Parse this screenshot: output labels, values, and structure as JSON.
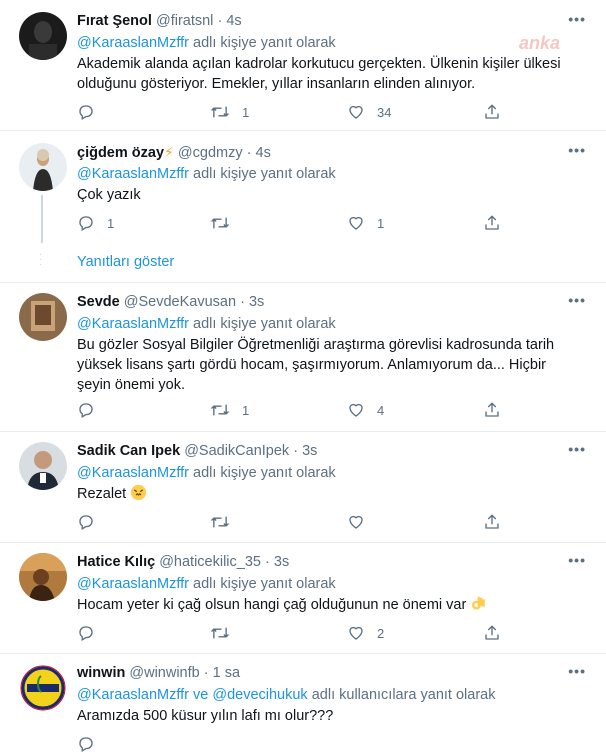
{
  "watermark": "anka",
  "reply_label": "adlı kişiye yanıt olarak",
  "reply_label_multi": "adlı kullanıcılara yanıt olarak",
  "show_replies": "Yanıtları göster",
  "more_glyph": "•••",
  "tweets": [
    {
      "name": "Fırat Şenol",
      "handle": "@firatsnl",
      "sep": "·",
      "time": "4s",
      "reply_to": "@KaraaslanMzffr",
      "lines": [
        "Akademik alanda açılan kadrolar korkutucu gerçekten. Ülkenin kişiler ülkesi",
        "olduğunu gösteriyor. Emekler, yıllar insanların elinden alınıyor."
      ],
      "replies": "",
      "retweets": "1",
      "likes": "34"
    },
    {
      "name": "çiğdem özay",
      "handle": "@cgdmzy",
      "sep": "·",
      "time": "4s",
      "reply_to": "@KaraaslanMzffr",
      "lines": [
        "Çok yazık"
      ],
      "replies": "1",
      "retweets": "",
      "likes": "1"
    },
    {
      "name": "Sevde",
      "handle": "@SevdeKavusan",
      "sep": "·",
      "time": "3s",
      "reply_to": "@KaraaslanMzffr",
      "lines": [
        "Bu gözler Sosyal Bilgiler Öğretmenliği araştırma görevlisi kadrosunda tarih",
        "yüksek lisans şartı gördü hocam, şaşırmıyorum. Anlamıyorum da... Hiçbir",
        "şeyin önemi yok."
      ],
      "replies": "",
      "retweets": "1",
      "likes": "4"
    },
    {
      "name": "Sadik Can Ipek",
      "handle": "@SadikCanIpek",
      "sep": "·",
      "time": "3s",
      "reply_to": "@KaraaslanMzffr",
      "lines": [
        "Rezalet"
      ],
      "replies": "",
      "retweets": "",
      "likes": ""
    },
    {
      "name": "Hatice Kılıç",
      "handle": "@haticekilic_35",
      "sep": "·",
      "time": "3s",
      "reply_to": "@KaraaslanMzffr",
      "lines": [
        "Hocam yeter ki çağ olsun hangi çağ olduğunun ne önemi var"
      ],
      "replies": "",
      "retweets": "",
      "likes": "2"
    },
    {
      "name": "winwin",
      "handle": "@winwinfb",
      "sep": "·",
      "time": "1 sa",
      "reply_to": "@KaraaslanMzffr",
      "reply_joiner": "ve",
      "reply_to_2": "@devecihukuk",
      "lines": [
        "Aramızda 500 küsur yılın lafı mı olur???"
      ],
      "replies": "",
      "retweets": "",
      "likes": ""
    }
  ]
}
